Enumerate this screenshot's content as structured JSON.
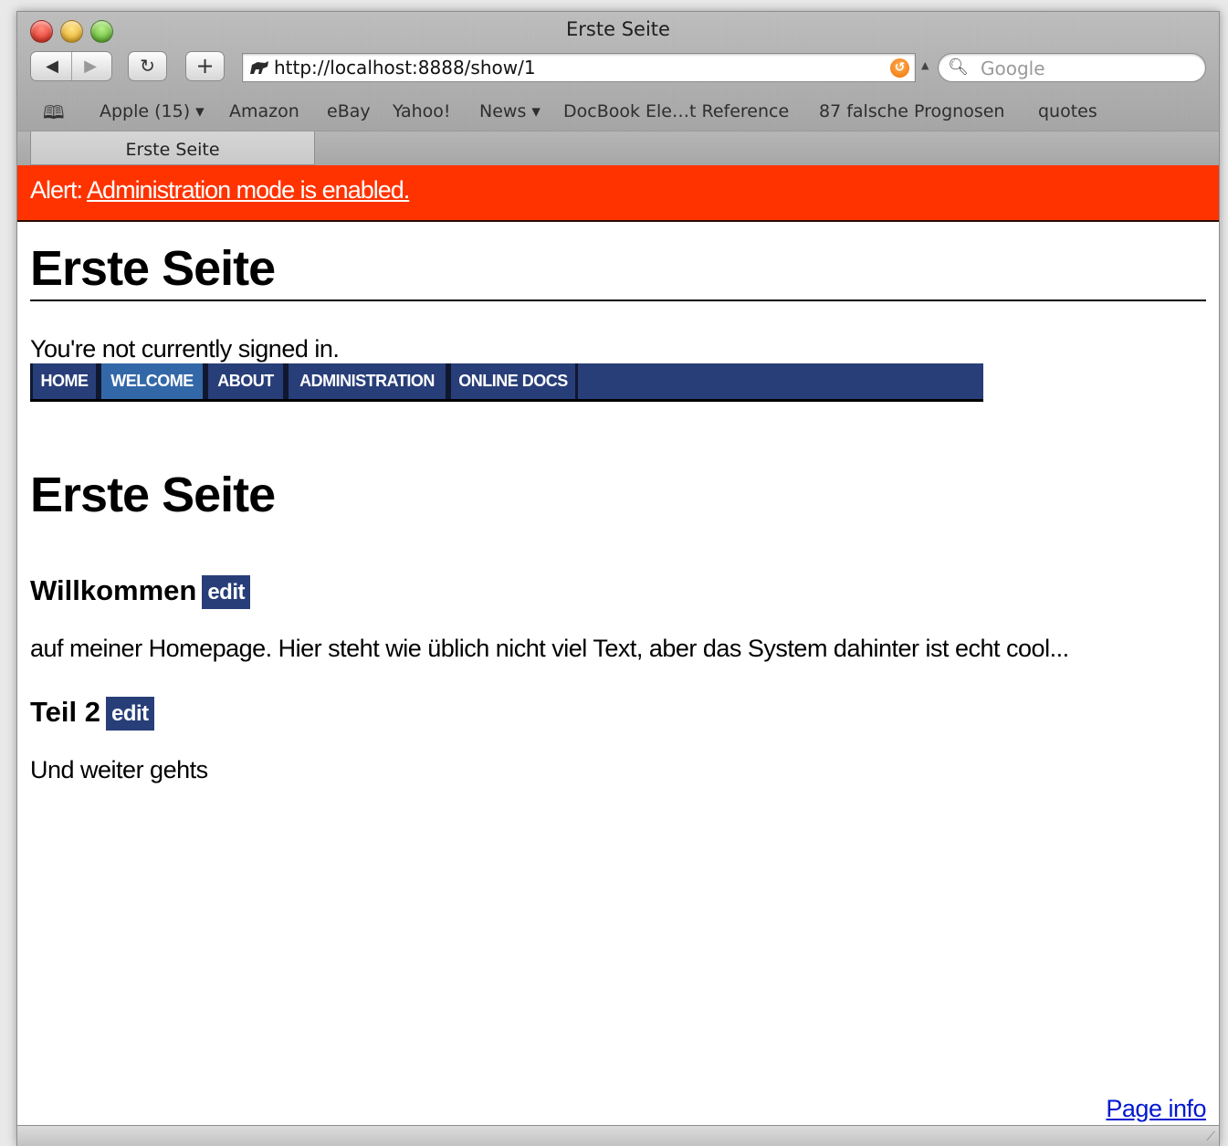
{
  "window": {
    "title": "Erste Seite"
  },
  "toolbar": {
    "url": "http://localhost:8888/show/1",
    "search_placeholder": "Google"
  },
  "bookmarks": [
    "Apple (15) ▾",
    "Amazon",
    "eBay",
    "Yahoo!",
    "News ▾",
    "DocBook Ele…t Reference",
    "87 falsche Prognosen",
    "quotes"
  ],
  "tab": {
    "label": "Erste Seite"
  },
  "alert": {
    "prefix": "Alert:",
    "link": "Administration mode is enabled."
  },
  "page": {
    "heading": "Erste Seite",
    "signin": "You're not currently signed in.",
    "menu": [
      "HOME",
      "WELCOME",
      "ABOUT",
      "ADMINISTRATION",
      "ONLINE DOCS"
    ],
    "active_menu": "WELCOME",
    "main_heading": "Erste Seite",
    "sections": [
      {
        "title": "Willkommen",
        "edit": "edit",
        "text": "auf meiner Homepage. Hier steht wie üblich nicht viel Text, aber das System dahinter ist echt cool..."
      },
      {
        "title": "Teil 2",
        "edit": "edit",
        "text": "Und weiter gehts"
      }
    ],
    "page_info": "Page info"
  },
  "colors": {
    "alert_bg": "#ff3300",
    "menu_bg": "#283e78",
    "menu_active": "#3368a8",
    "link": "#0018d0"
  }
}
